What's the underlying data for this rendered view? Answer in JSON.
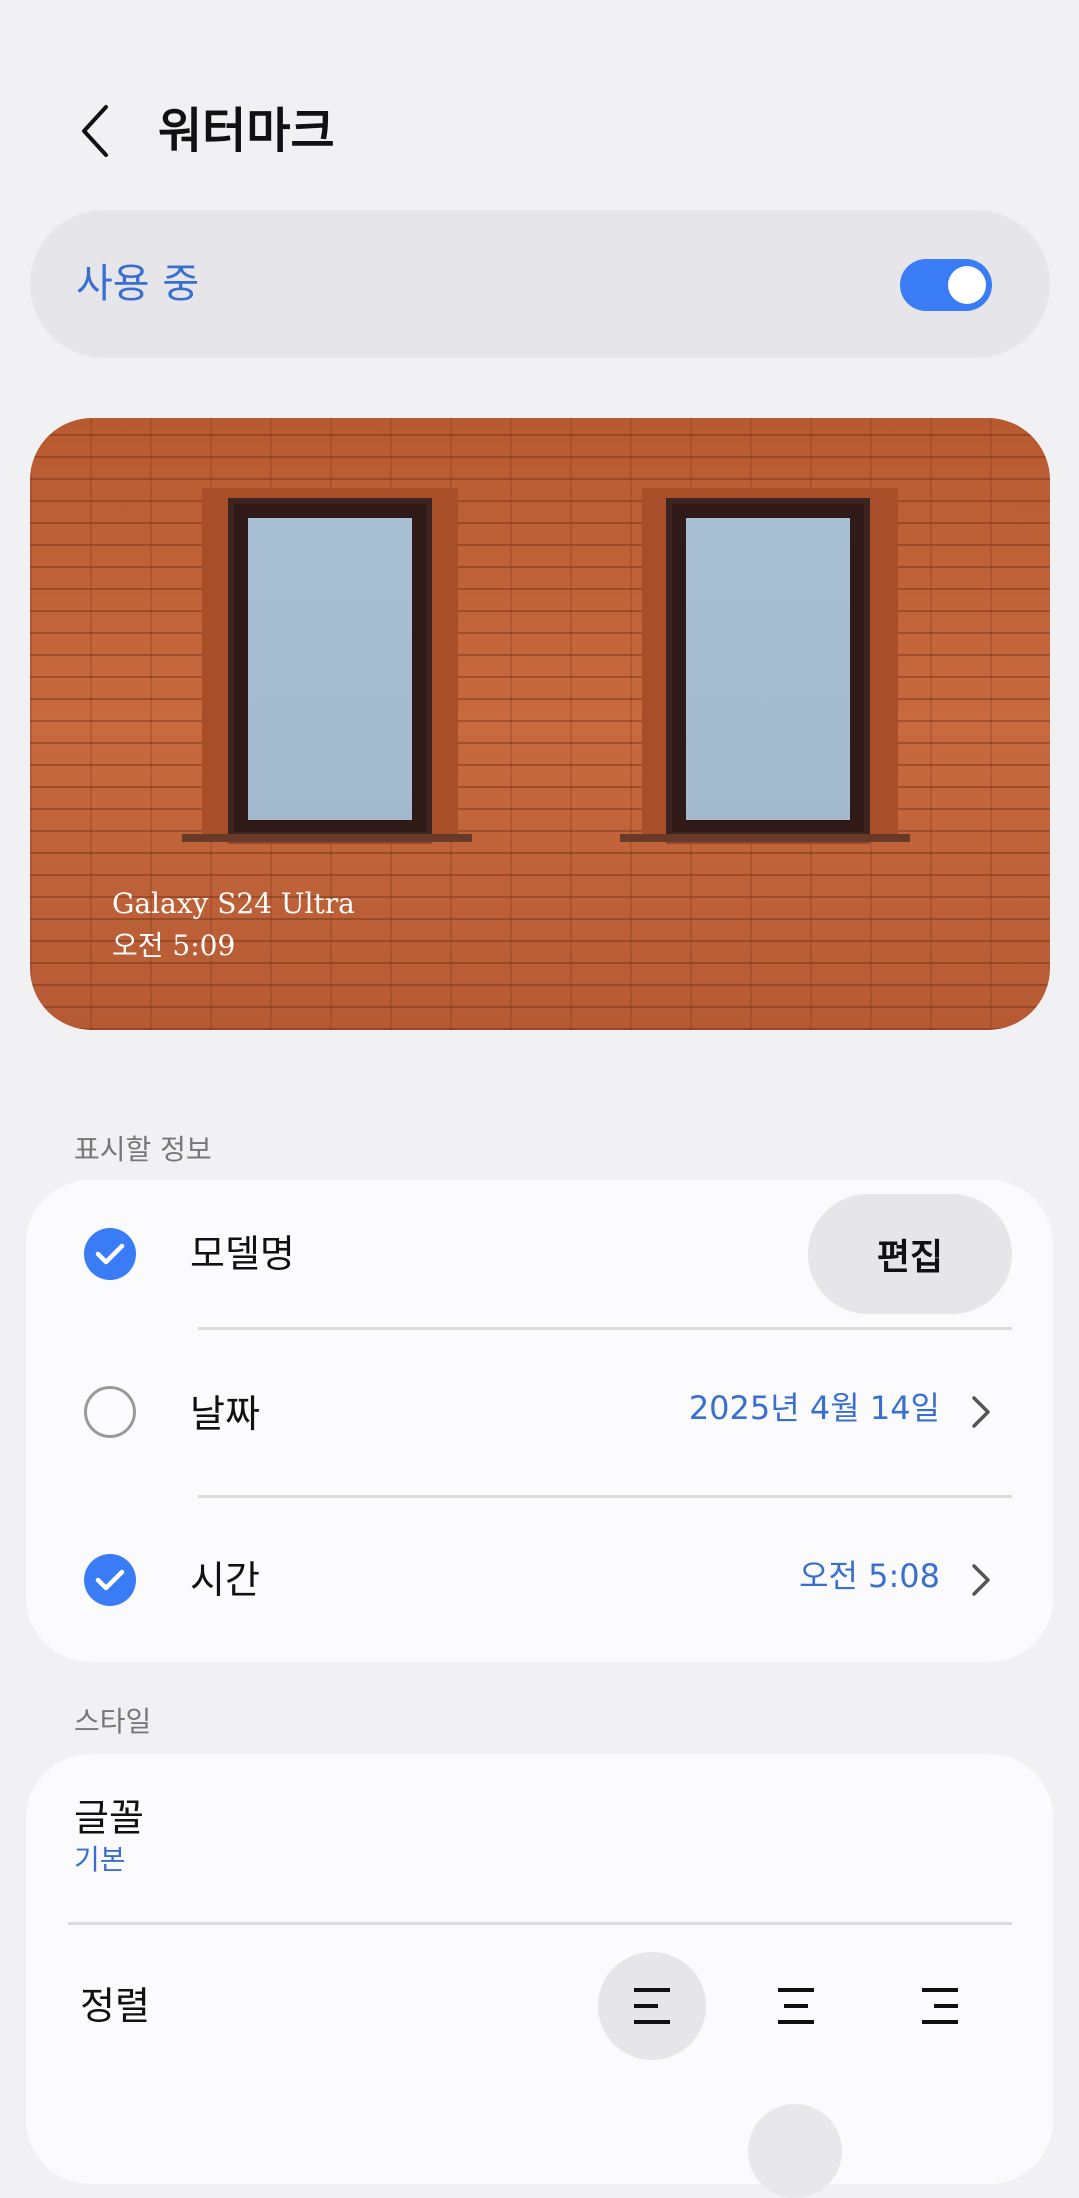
{
  "header": {
    "title": "워터마크",
    "back_icon": "chevron-left-icon"
  },
  "master_switch": {
    "label": "사용 중",
    "on": true,
    "accent": "#3a7cf5"
  },
  "preview": {
    "watermark_model": "Galaxy S24 Ultra",
    "watermark_time": "오전 5:09"
  },
  "info_section": {
    "header": "표시할 정보",
    "rows": [
      {
        "label": "모델명",
        "checked": true,
        "action": "편집"
      },
      {
        "label": "날짜",
        "checked": false,
        "value": "2025년 4월 14일"
      },
      {
        "label": "시간",
        "checked": true,
        "value": "오전 5:08"
      }
    ]
  },
  "style_section": {
    "header": "스타일",
    "font": {
      "label": "글꼴",
      "value": "기본"
    },
    "alignment": {
      "label": "정렬",
      "options": [
        "left",
        "center",
        "right"
      ],
      "selected": "left"
    }
  },
  "colors": {
    "accent_text": "#3a6fcf",
    "toggle": "#3a7cf5",
    "background": "#f1f1f3"
  }
}
